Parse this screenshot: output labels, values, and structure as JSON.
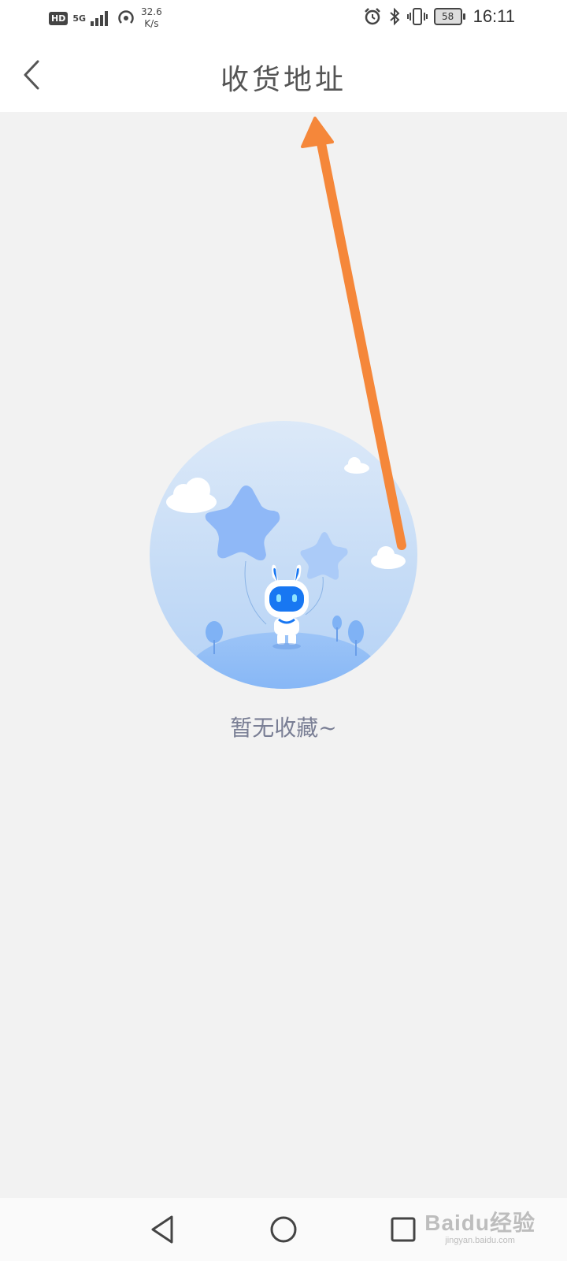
{
  "status_bar": {
    "hd_badge": "HD",
    "network": "5G",
    "speed_value": "32.6",
    "speed_unit": "K/s",
    "battery": "58",
    "time": "16:11",
    "icons": [
      "signal-icon",
      "hotspot-icon",
      "alarm-icon",
      "bluetooth-icon",
      "vibrate-icon",
      "battery-icon"
    ]
  },
  "header": {
    "title": "收货地址",
    "back_icon": "chevron-left-icon"
  },
  "empty_state": {
    "message": "暂无收藏~",
    "illustration": "robot-with-balloons-illustration"
  },
  "annotation": {
    "arrow_color": "#f5873a"
  },
  "nav_bar": {
    "buttons": [
      "back-triangle-icon",
      "home-circle-icon",
      "recents-square-icon"
    ]
  },
  "watermark": {
    "main": "Baidu经验",
    "sub": "jingyan.baidu.com"
  },
  "colors": {
    "background": "#f2f2f2",
    "header": "#ffffff",
    "illustration_blue": "#7fb2f5",
    "robot_face": "#1877f2"
  }
}
